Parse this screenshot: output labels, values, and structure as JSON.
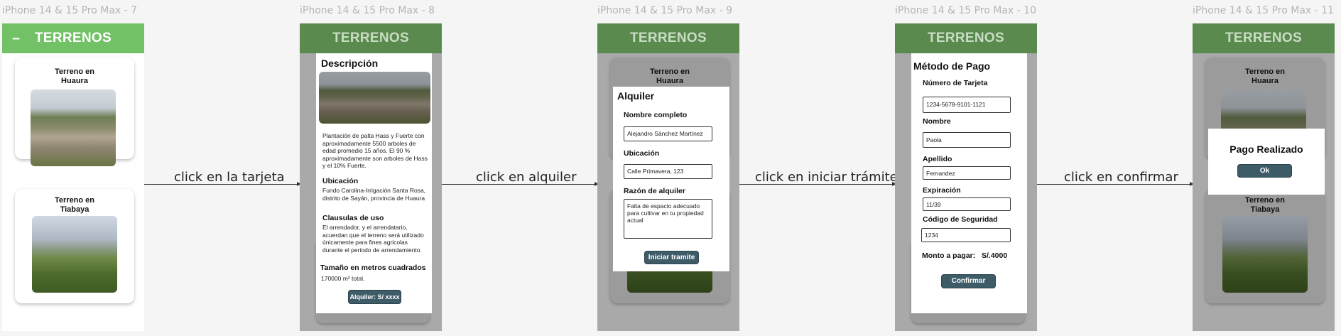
{
  "frames": [
    {
      "label": "iPhone 14 & 15 Pro Max - 7"
    },
    {
      "label": "iPhone 14 & 15 Pro Max - 8"
    },
    {
      "label": "iPhone 14 & 15 Pro Max - 9"
    },
    {
      "label": "iPhone 14 & 15 Pro Max - 10"
    },
    {
      "label": "iPhone 14 & 15 Pro Max - 11"
    }
  ],
  "app": {
    "title": "TERRENOS",
    "menu_glyph": "–"
  },
  "cards": [
    {
      "title_line1": "Terreno en",
      "title_line2": "Huaura"
    },
    {
      "title_line1": "Terreno en",
      "title_line2": "Tiabaya"
    }
  ],
  "edges": [
    {
      "label": "click en la tarjeta"
    },
    {
      "label": "click en alquiler"
    },
    {
      "label": "click en iniciar trámite"
    },
    {
      "label": "click en confirmar"
    }
  ],
  "detail": {
    "heading": "Descripción",
    "description": "Plantación de palta Hass y Fuerte con aproximadamente 5500 arboles de edad promedio 15 años. El 90 % aproximadamente son arboles de Hass y el 10% Fuerte.",
    "location_heading": "Ubicación",
    "location_text": "Fundo Carolina-Irrigación Santa Rosa, distrito de Sayán, provincia de Huaura",
    "clauses_heading": "Clausulas de uso",
    "clauses_text": "El arrendador, y el arrendatario, acuerdan que el terreno será utilizado únicamente para fines agricolas durante el periodo de arrendamiento.",
    "size_heading": "Tamaño en metros cuadrados",
    "size_text": "170000 m² total.",
    "rent_button": "Alquiler: S/ xxxx"
  },
  "rental_modal": {
    "heading": "Alquiler",
    "name_label": "Nombre completo",
    "name_value": "Alejandro Sánchez Martínez",
    "location_label": "Ubicación",
    "location_value": "Calle Primavera, 123",
    "reason_label": "Razón de alquiler",
    "reason_value": "Falta de espacio adecuado para cultivar en tu propiedad actual",
    "submit_button": "Iniciar tramite"
  },
  "payment": {
    "heading": "Método de Pago",
    "card_label": "Número de Tarjeta",
    "card_value": "1234-5678-9101-1121",
    "first_name_label": "Nombre",
    "first_name_value": "Paola",
    "last_name_label": "Apellido",
    "last_name_value": "Fernandez",
    "expiry_label": "Expiración",
    "expiry_value": "11/39",
    "cvv_label": "Código de Seguridad",
    "cvv_value": "1234",
    "amount_label": "Monto a pagar:",
    "amount_value": "S/.4000",
    "confirm_button": "Confirmar"
  },
  "success_modal": {
    "title": "Pago Realizado",
    "ok_button": "Ok"
  },
  "colors": {
    "appbar_active": "#72c166",
    "appbar_dim": "#5a8a4e",
    "button": "#3e5b68",
    "overlay": "#a9a9a9"
  }
}
